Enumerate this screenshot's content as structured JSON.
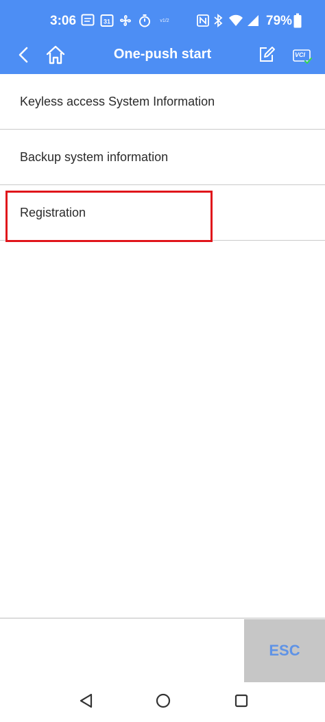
{
  "status_bar": {
    "time": "3:06",
    "battery": "79%",
    "icons": [
      "message-icon",
      "calendar-icon",
      "fan-icon",
      "timer-icon",
      "vpn-icon",
      "nfc-icon",
      "bluetooth-icon",
      "wifi-icon",
      "signal-icon",
      "battery-icon"
    ],
    "calendar_day": "31",
    "vpn_text": "v1/2"
  },
  "header": {
    "title": "One-push start",
    "vci_label": "VCI"
  },
  "list": {
    "items": [
      {
        "label": "Keyless access System  Information"
      },
      {
        "label": "Backup system information"
      },
      {
        "label": "Registration"
      }
    ]
  },
  "footer": {
    "esc_label": "ESC"
  },
  "colors": {
    "header_bg": "#4d8ef4",
    "highlight": "#e0151b",
    "esc_text": "#5f93e6"
  }
}
